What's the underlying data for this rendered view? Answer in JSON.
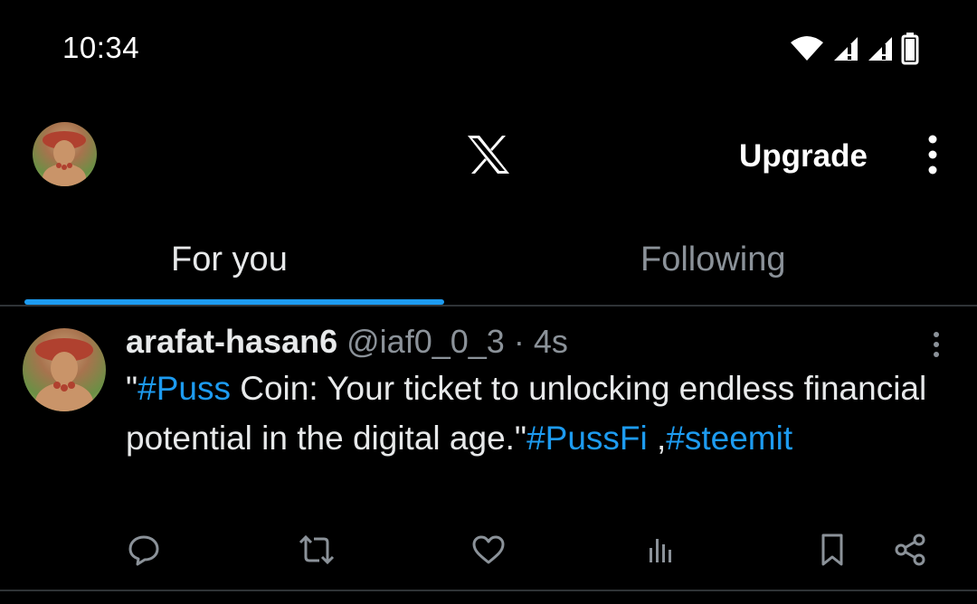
{
  "status_bar": {
    "time": "10:34",
    "icons": [
      "wifi-icon",
      "signal-icon",
      "signal-icon",
      "battery-icon"
    ]
  },
  "header": {
    "logo_icon": "x-logo-icon",
    "upgrade_label": "Upgrade",
    "menu_icon": "more-vert-icon"
  },
  "tabs": [
    {
      "label": "For you",
      "active": true
    },
    {
      "label": "Following",
      "active": false
    }
  ],
  "post": {
    "display_name": "arafat-hasan6",
    "handle": "@iaf0_0_3",
    "separator": "·",
    "time": "4s",
    "text": {
      "open_quote": "\"",
      "hashtag1": "#Puss",
      "body": " Coin: Your ticket to unlocking endless financial potential in the digital age.\"",
      "hashtag2": "#PussFi",
      "separator": " ,",
      "hashtag3": "#steemit"
    },
    "actions": [
      "reply-icon",
      "retweet-icon",
      "like-icon",
      "views-icon",
      "bookmark-icon",
      "share-icon"
    ]
  },
  "colors": {
    "background": "#000000",
    "accent": "#1d9bf0",
    "text_primary": "#e7e9ea",
    "text_secondary": "#8b9299",
    "divider": "#2f3336"
  }
}
